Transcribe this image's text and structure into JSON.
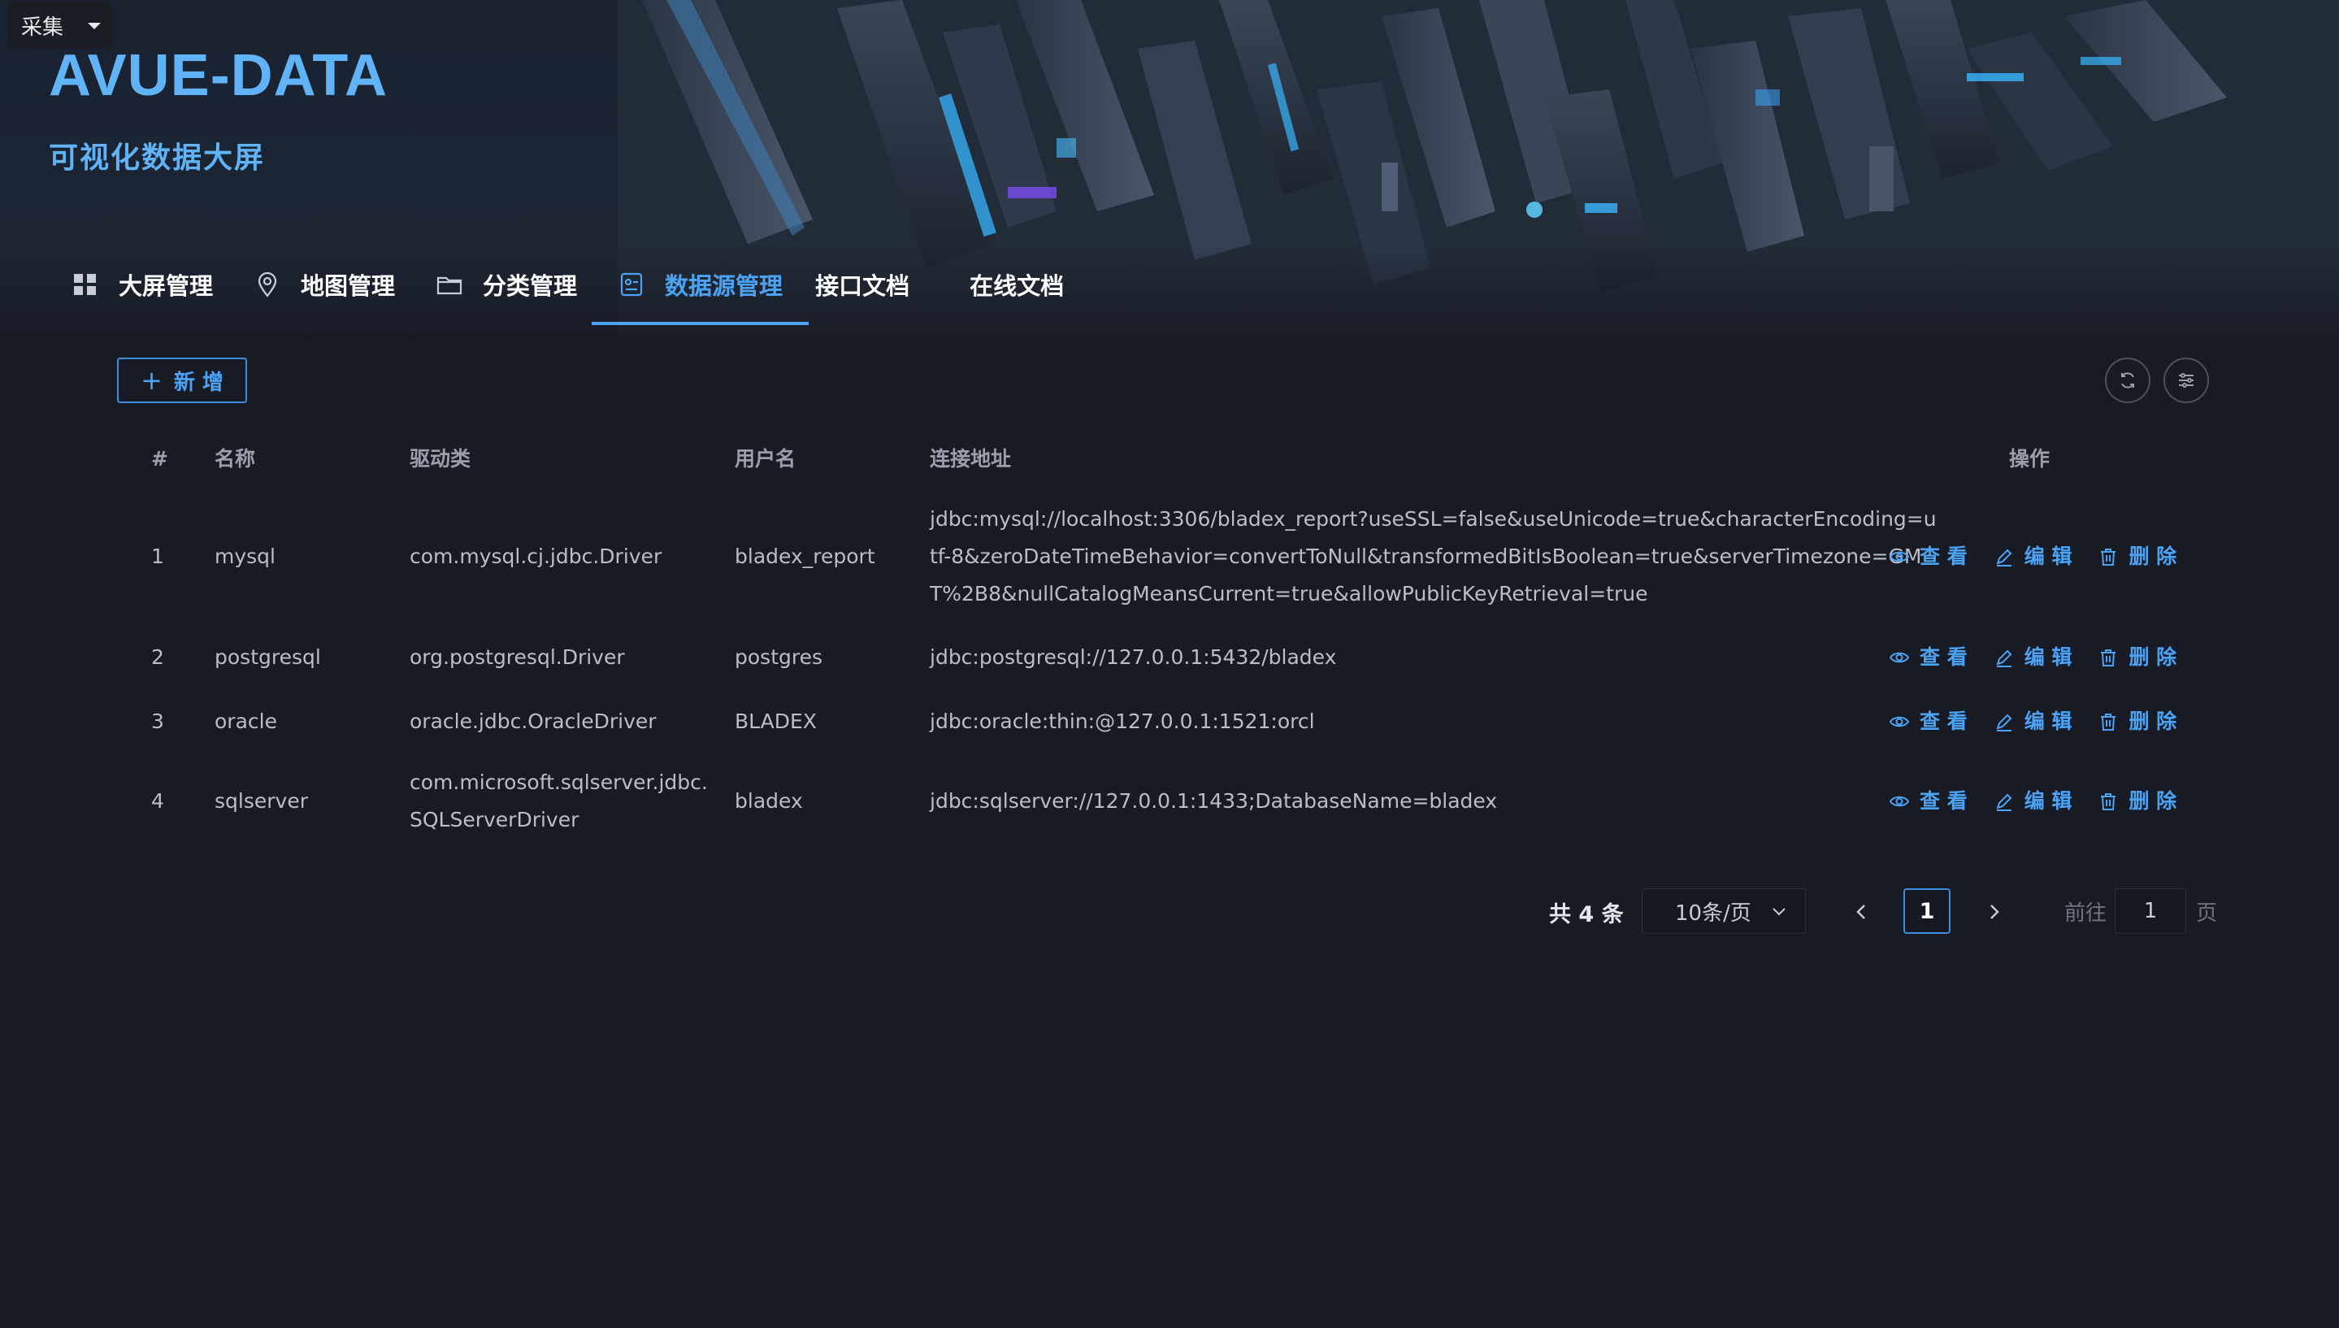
{
  "collect_button": {
    "label": "采集"
  },
  "brand": {
    "title": "AVUE-DATA",
    "subtitle": "可视化数据大屏"
  },
  "nav": [
    {
      "label": "大屏管理",
      "icon": "grid-icon",
      "active": false
    },
    {
      "label": "地图管理",
      "icon": "map-pin-icon",
      "active": false
    },
    {
      "label": "分类管理",
      "icon": "folder-icon",
      "active": false
    },
    {
      "label": "数据源管理",
      "icon": "datasource-icon",
      "active": true
    },
    {
      "label": "接口文档",
      "icon": "",
      "active": false
    },
    {
      "label": "在线文档",
      "icon": "",
      "active": false
    }
  ],
  "toolbar": {
    "add_label": "新 增",
    "add_icon": "plus-icon",
    "refresh_icon": "refresh-icon",
    "columns_icon": "sliders-icon"
  },
  "table": {
    "headers": {
      "idx": "#",
      "name": "名称",
      "driver": "驱动类",
      "user": "用户名",
      "url": "连接地址",
      "ops": "操作"
    },
    "rows": [
      {
        "idx": "1",
        "name": "mysql",
        "driver": "com.mysql.cj.jdbc.Driver",
        "user": "bladex_report",
        "url": "jdbc:mysql://localhost:3306/bladex_report?useSSL=false&useUnicode=true&characterEncoding=utf-8&zeroDateTimeBehavior=convertToNull&transformedBitIsBoolean=true&serverTimezone=GMT%2B8&nullCatalogMeansCurrent=true&allowPublicKeyRetrieval=true"
      },
      {
        "idx": "2",
        "name": "postgresql",
        "driver": "org.postgresql.Driver",
        "user": "postgres",
        "url": "jdbc:postgresql://127.0.0.1:5432/bladex"
      },
      {
        "idx": "3",
        "name": "oracle",
        "driver": "oracle.jdbc.OracleDriver",
        "user": "BLADEX",
        "url": "jdbc:oracle:thin:@127.0.0.1:1521:orcl"
      },
      {
        "idx": "4",
        "name": "sqlserver",
        "driver": "com.microsoft.sqlserver.jdbc.SQLServerDriver",
        "user": "bladex",
        "url": "jdbc:sqlserver://127.0.0.1:1433;DatabaseName=bladex"
      }
    ],
    "actions": {
      "view": "查 看",
      "edit": "编 辑",
      "delete": "删 除"
    }
  },
  "pagination": {
    "total": "共 4 条",
    "page_size": "10条/页",
    "current_page": "1",
    "goto_label": "前往",
    "goto_value": "1",
    "page_label": "页"
  },
  "colors": {
    "accent": "#4aa3f5",
    "background": "#181b24"
  }
}
